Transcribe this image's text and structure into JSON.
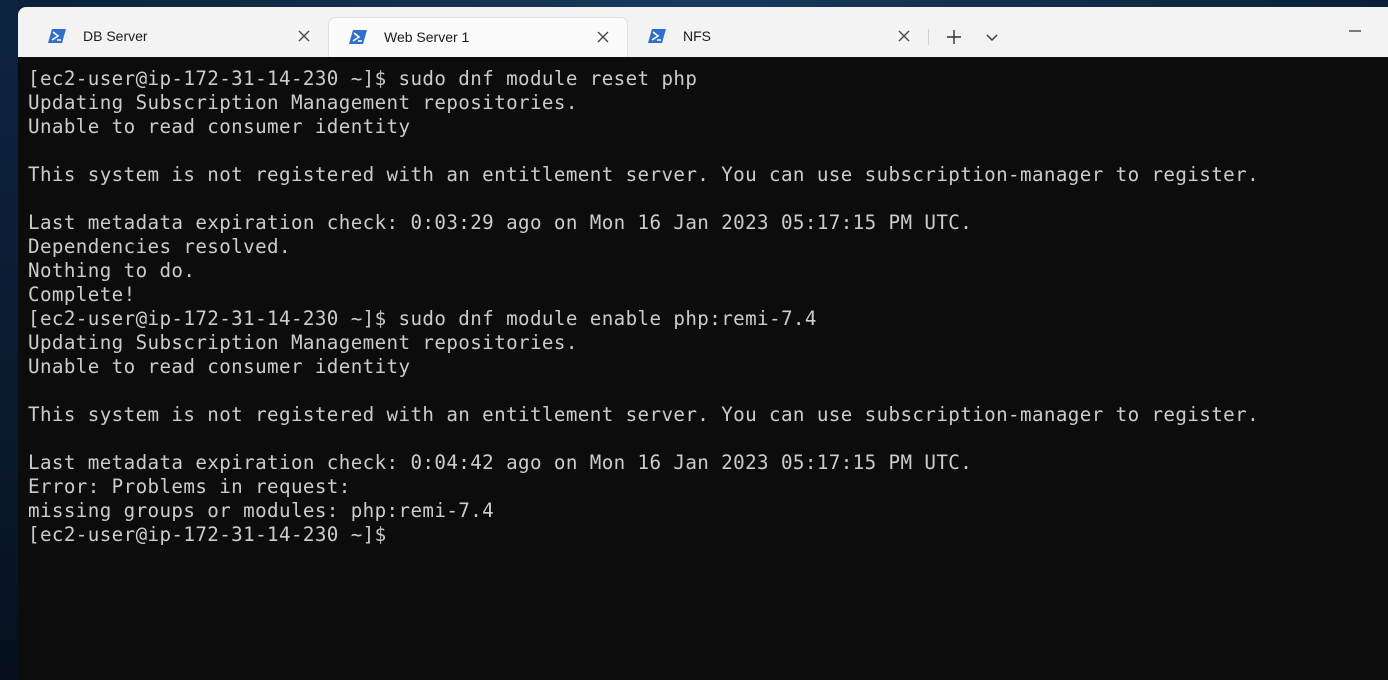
{
  "tabs": [
    {
      "label": "DB Server",
      "icon": "powershell-icon",
      "active": false
    },
    {
      "label": "Web Server 1",
      "icon": "powershell-icon",
      "active": true
    },
    {
      "label": "NFS",
      "icon": "powershell-icon",
      "active": false
    }
  ],
  "colors": {
    "tab_bar_bg": "#f3f3f3",
    "active_tab_bg": "#fbfbfb",
    "terminal_bg": "#0c0c0c",
    "terminal_fg": "#cccccc",
    "powershell_blue": "#2f6fc9"
  },
  "terminal": {
    "lines": [
      "[ec2-user@ip-172-31-14-230 ~]$ sudo dnf module reset php",
      "Updating Subscription Management repositories.",
      "Unable to read consumer identity",
      "",
      "This system is not registered with an entitlement server. You can use subscription-manager to register.",
      "",
      "Last metadata expiration check: 0:03:29 ago on Mon 16 Jan 2023 05:17:15 PM UTC.",
      "Dependencies resolved.",
      "Nothing to do.",
      "Complete!",
      "[ec2-user@ip-172-31-14-230 ~]$ sudo dnf module enable php:remi-7.4",
      "Updating Subscription Management repositories.",
      "Unable to read consumer identity",
      "",
      "This system is not registered with an entitlement server. You can use subscription-manager to register.",
      "",
      "Last metadata expiration check: 0:04:42 ago on Mon 16 Jan 2023 05:17:15 PM UTC.",
      "Error: Problems in request:",
      "missing groups or modules: php:remi-7.4",
      "[ec2-user@ip-172-31-14-230 ~]$"
    ]
  }
}
